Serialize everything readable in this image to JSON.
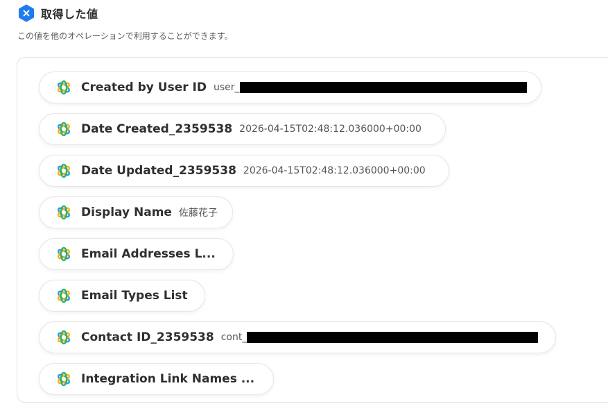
{
  "header": {
    "title": "取得した値",
    "subtitle": "この値を他のオペレーションで利用することができます。",
    "icon": "x-hexagon-icon",
    "icon_color": "#1e7bf0"
  },
  "items": [
    {
      "label": "Created by User ID",
      "value": "user_",
      "redacted": true
    },
    {
      "label": "Date Created_2359538",
      "value": "2026-04-15T02:48:12.036000+00:00"
    },
    {
      "label": "Date Updated_2359538",
      "value": "2026-04-15T02:48:12.036000+00:00"
    },
    {
      "label": "Display Name",
      "value": "佐藤花子"
    },
    {
      "label": "Email Addresses L...",
      "value": ""
    },
    {
      "label": "Email Types List",
      "value": ""
    },
    {
      "label": "Contact ID_2359538",
      "value": "cont_",
      "redacted": true
    },
    {
      "label": "Integration Link Names ...",
      "value": ""
    }
  ],
  "colors": {
    "chip_border": "#e6e6e6",
    "panel_border": "#e2e2e2"
  }
}
